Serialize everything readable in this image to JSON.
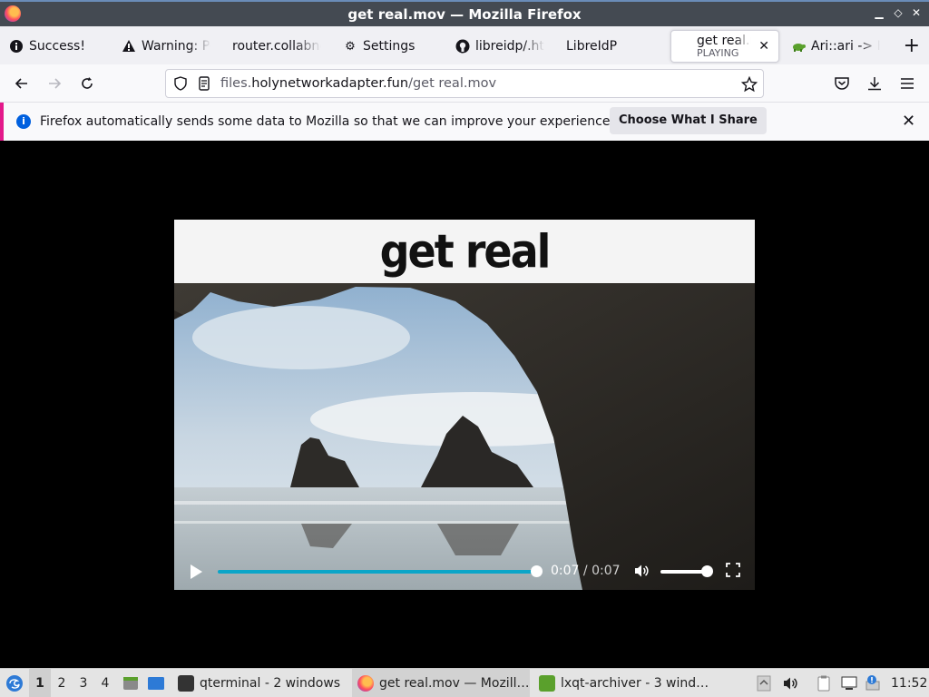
{
  "window": {
    "title": "get real.mov — Mozilla Firefox",
    "controls": [
      "▁",
      "◇",
      "✕"
    ]
  },
  "tabs": [
    {
      "label": "Success!",
      "icon": "info-icon"
    },
    {
      "label": "Warning: Po",
      "icon": "warning-icon"
    },
    {
      "label": "router.collabne",
      "icon": ""
    },
    {
      "label": "Settings",
      "icon": "gear-icon"
    },
    {
      "label": "libreidp/.hta",
      "icon": "github-icon"
    },
    {
      "label": "LibreIdP",
      "icon": ""
    },
    {
      "label": "get real.m",
      "sublabel": "PLAYING",
      "icon": "",
      "active": true
    },
    {
      "label": "Ari::ari -> Fl",
      "icon": "turtle-icon"
    }
  ],
  "newtab_label": "+",
  "nav": {
    "url_prefix": "files.",
    "url_host": "holynetworkadapter.fun",
    "url_path": "/get real.mov"
  },
  "notification": {
    "message": "Firefox automatically sends some data to Mozilla so that we can improve your experience.",
    "button": "Choose What I Share"
  },
  "video": {
    "caption": "get real",
    "time_current": "0:07",
    "time_separator": "/",
    "time_total": "0:07",
    "progress": 1.0,
    "volume": 1.0
  },
  "taskbar": {
    "desktops": [
      "1",
      "2",
      "3",
      "4"
    ],
    "active_desktop": "1",
    "tasks": [
      {
        "label": "qterminal - 2 windows",
        "icon": "terminal-icon"
      },
      {
        "label": "get real.mov — Mozill…",
        "icon": "firefox-icon",
        "active": true
      },
      {
        "label": "lxqt-archiver - 3 wind…",
        "icon": "archiver-icon"
      }
    ],
    "clock": "11:52"
  },
  "colors": {
    "accent": "#0ba5c8",
    "notification_border": "#e3198a",
    "info_blue": "#0060df"
  }
}
